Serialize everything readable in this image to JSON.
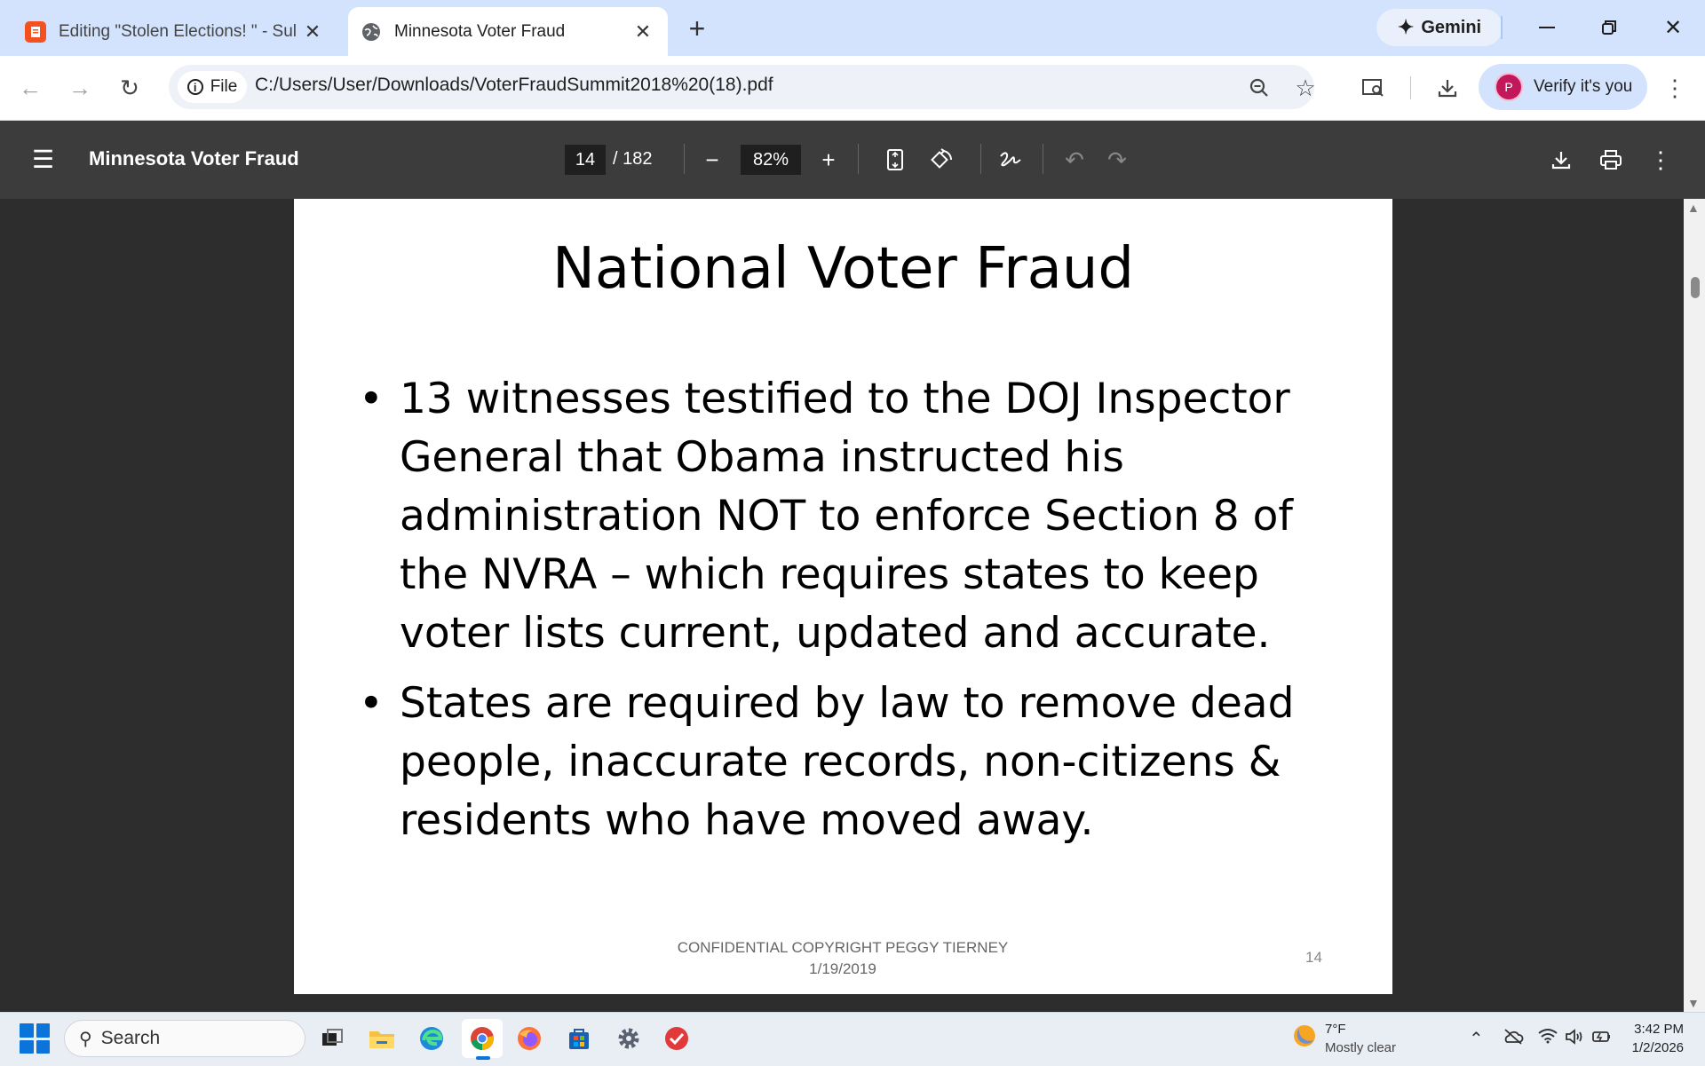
{
  "browser": {
    "tabs": [
      {
        "title": "Editing \"Stolen Elections! \" - Sul",
        "active": false
      },
      {
        "title": "Minnesota Voter Fraud",
        "active": true
      }
    ],
    "new_tab": "+",
    "gemini_label": "Gemini",
    "site_info_label": "File",
    "url": "C:/Users/User/Downloads/VoterFraudSummit2018%20(18).pdf",
    "profile_initial": "P",
    "verify_label": "Verify it's you",
    "colors": {
      "tabstrip": "#d3e3fd",
      "verify_bg": "#d3e3fd",
      "avatar": "#c2185b"
    }
  },
  "pdf_toolbar": {
    "title": "Minnesota Voter Fraud",
    "current_page": "14",
    "total_pages": "/ 182",
    "zoom": "82%"
  },
  "slide": {
    "title": "National Voter Fraud",
    "bullets": [
      "13 witnesses testified to the DOJ Inspector General that Obama instructed his administration NOT to enforce Section 8 of the NVRA – which requires states to keep voter lists current, updated and accurate.",
      "States are required by law to remove dead people, inaccurate records, non-citizens & residents who have moved away."
    ],
    "bullet_char": "•",
    "footer_line1": "CONFIDENTIAL COPYRIGHT PEGGY TIERNEY",
    "footer_line2": "1/19/2019",
    "page_number": "14"
  },
  "taskbar": {
    "search_label": "Search",
    "weather_temp": "7°F",
    "weather_desc": "Mostly clear",
    "time": "3:42 PM",
    "date": "1/2/2026"
  }
}
